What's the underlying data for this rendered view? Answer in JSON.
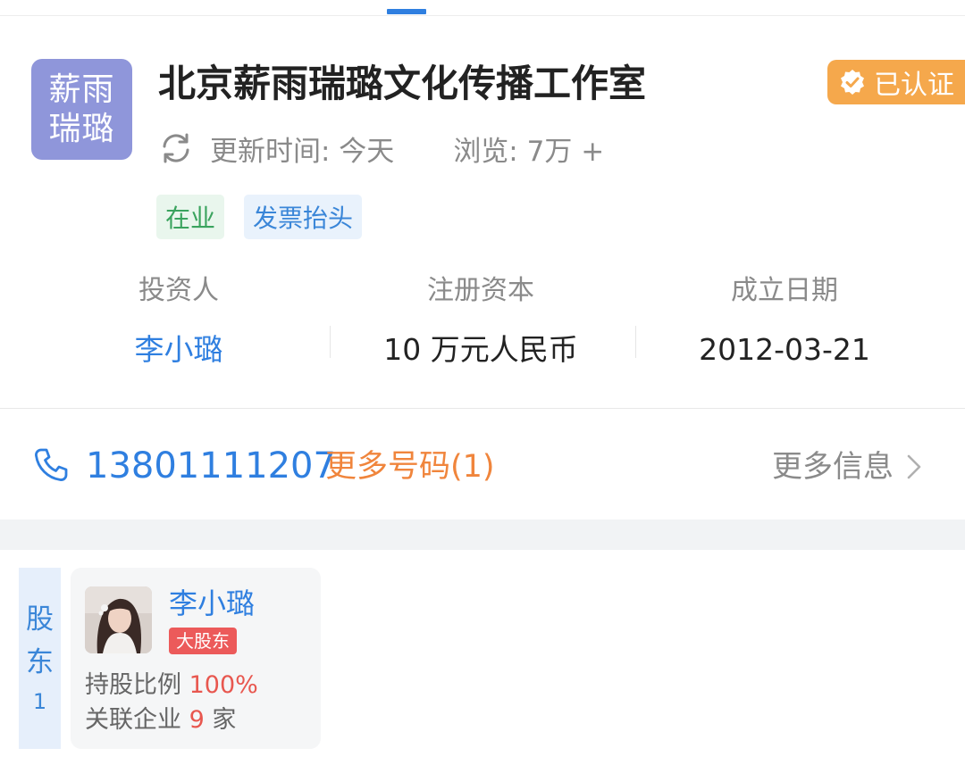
{
  "logo_text": [
    "薪雨",
    "瑞璐"
  ],
  "company": {
    "name": "北京薪雨瑞璐文化传播工作室",
    "cert_label": "已认证",
    "update_label": "更新时间: 今天",
    "views_label": "浏览: 7万 +"
  },
  "tags": [
    "在业",
    "发票抬头"
  ],
  "info": [
    {
      "label": "投资人",
      "value": "李小璐"
    },
    {
      "label": "注册资本",
      "value": "10 万元人民币"
    },
    {
      "label": "成立日期",
      "value": "2012-03-21"
    }
  ],
  "contact": {
    "phone": "13801111207",
    "more_numbers": "更多号码(1)",
    "more_info": "更多信息"
  },
  "shareholders": {
    "section_label": [
      "股",
      "东"
    ],
    "count": "1",
    "items": [
      {
        "name": "李小璐",
        "badge": "大股东",
        "ratio_label": "持股比例",
        "ratio_value": "100%",
        "related_label": "关联企业",
        "related_value": "9",
        "related_unit": "家"
      }
    ]
  },
  "colors": {
    "accent": "#2f7fe0",
    "cert": "#f5a84c",
    "orange": "#f0853c",
    "red": "#e8574f",
    "logo_bg": "#8f96da"
  },
  "icons": [
    "verified-check-icon",
    "refresh-icon",
    "phone-icon",
    "chevron-right-icon"
  ]
}
